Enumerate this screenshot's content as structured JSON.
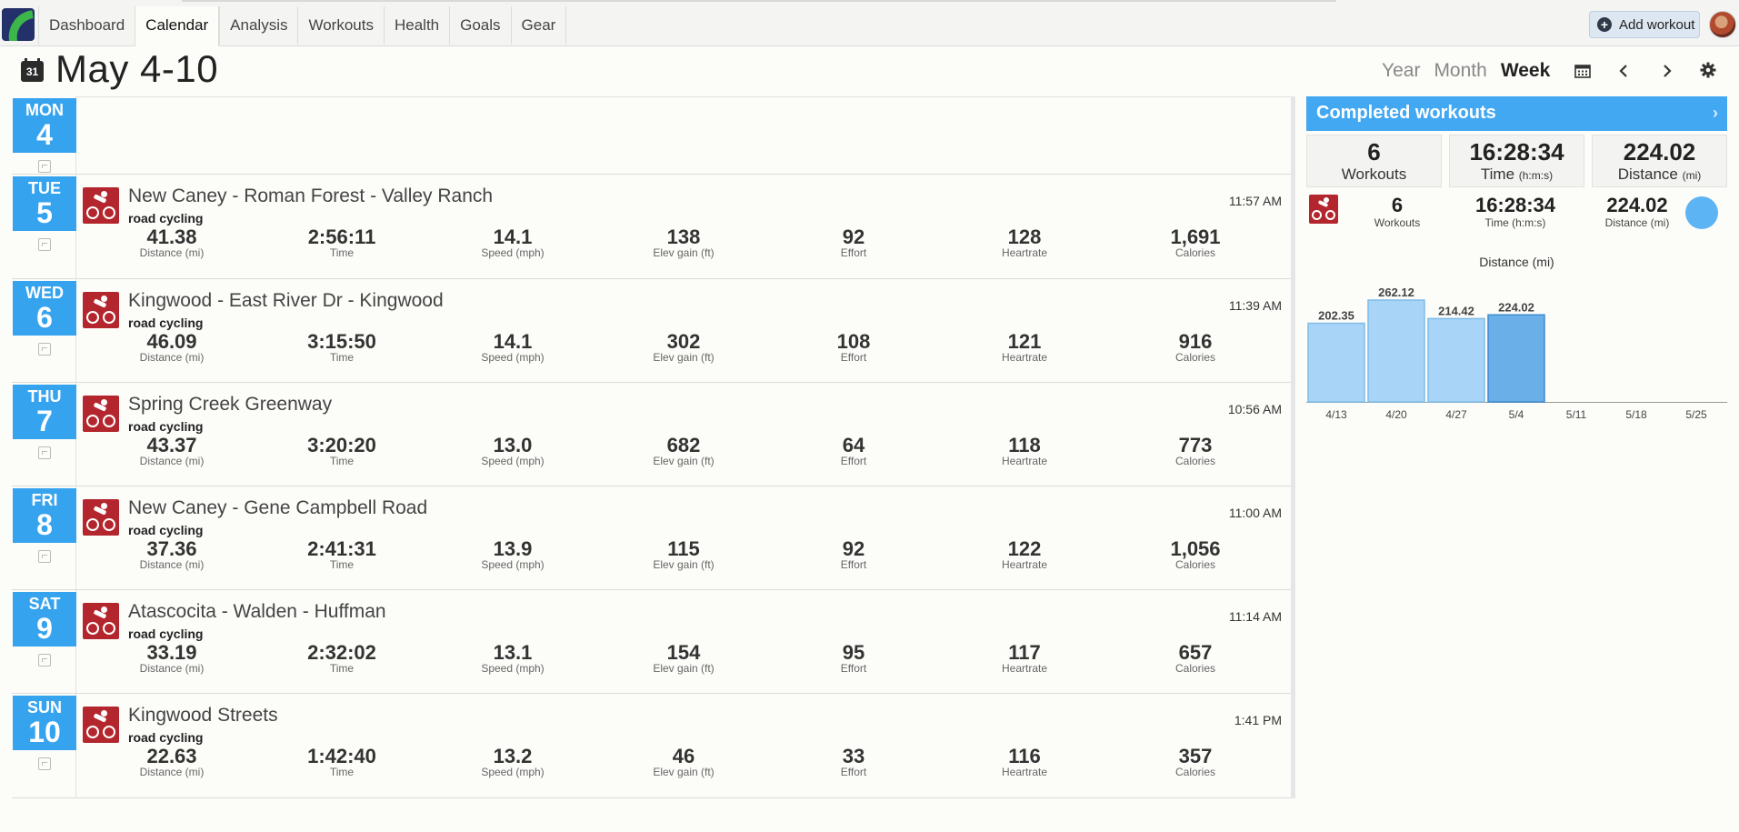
{
  "nav": {
    "tabs": [
      "Dashboard",
      "Calendar",
      "Analysis",
      "Workouts",
      "Health",
      "Goals",
      "Gear"
    ],
    "active_tab": "Calendar",
    "add_workout_label": "Add workout"
  },
  "header": {
    "calendar_icon_text": "31",
    "title": "May 4-10",
    "views": [
      "Year",
      "Month",
      "Week"
    ],
    "active_view": "Week"
  },
  "days": [
    {
      "dow": "MON",
      "dom": "4",
      "workout": null
    },
    {
      "dow": "TUE",
      "dom": "5",
      "workout": {
        "title": "New Caney - Roman Forest - Valley Ranch",
        "type": "road cycling",
        "time": "11:57 AM",
        "metrics": [
          {
            "value": "41.38",
            "label": "Distance (mi)"
          },
          {
            "value": "2:56:11",
            "label": "Time"
          },
          {
            "value": "14.1",
            "label": "Speed (mph)"
          },
          {
            "value": "138",
            "label": "Elev gain (ft)"
          },
          {
            "value": "92",
            "label": "Effort"
          },
          {
            "value": "128",
            "label": "Heartrate"
          },
          {
            "value": "1,691",
            "label": "Calories"
          }
        ]
      }
    },
    {
      "dow": "WED",
      "dom": "6",
      "workout": {
        "title": "Kingwood - East River Dr - Kingwood",
        "type": "road cycling",
        "time": "11:39 AM",
        "metrics": [
          {
            "value": "46.09",
            "label": "Distance (mi)"
          },
          {
            "value": "3:15:50",
            "label": "Time"
          },
          {
            "value": "14.1",
            "label": "Speed (mph)"
          },
          {
            "value": "302",
            "label": "Elev gain (ft)"
          },
          {
            "value": "108",
            "label": "Effort"
          },
          {
            "value": "121",
            "label": "Heartrate"
          },
          {
            "value": "916",
            "label": "Calories"
          }
        ]
      }
    },
    {
      "dow": "THU",
      "dom": "7",
      "workout": {
        "title": "Spring Creek Greenway",
        "type": "road cycling",
        "time": "10:56 AM",
        "metrics": [
          {
            "value": "43.37",
            "label": "Distance (mi)"
          },
          {
            "value": "3:20:20",
            "label": "Time"
          },
          {
            "value": "13.0",
            "label": "Speed (mph)"
          },
          {
            "value": "682",
            "label": "Elev gain (ft)"
          },
          {
            "value": "64",
            "label": "Effort"
          },
          {
            "value": "118",
            "label": "Heartrate"
          },
          {
            "value": "773",
            "label": "Calories"
          }
        ]
      }
    },
    {
      "dow": "FRI",
      "dom": "8",
      "workout": {
        "title": "New Caney - Gene Campbell Road",
        "type": "road cycling",
        "time": "11:00 AM",
        "metrics": [
          {
            "value": "37.36",
            "label": "Distance (mi)"
          },
          {
            "value": "2:41:31",
            "label": "Time"
          },
          {
            "value": "13.9",
            "label": "Speed (mph)"
          },
          {
            "value": "115",
            "label": "Elev gain (ft)"
          },
          {
            "value": "92",
            "label": "Effort"
          },
          {
            "value": "122",
            "label": "Heartrate"
          },
          {
            "value": "1,056",
            "label": "Calories"
          }
        ]
      }
    },
    {
      "dow": "SAT",
      "dom": "9",
      "workout": {
        "title": "Atascocita - Walden - Huffman",
        "type": "road cycling",
        "time": "11:14 AM",
        "metrics": [
          {
            "value": "33.19",
            "label": "Distance (mi)"
          },
          {
            "value": "2:32:02",
            "label": "Time"
          },
          {
            "value": "13.1",
            "label": "Speed (mph)"
          },
          {
            "value": "154",
            "label": "Elev gain (ft)"
          },
          {
            "value": "95",
            "label": "Effort"
          },
          {
            "value": "117",
            "label": "Heartrate"
          },
          {
            "value": "657",
            "label": "Calories"
          }
        ]
      }
    },
    {
      "dow": "SUN",
      "dom": "10",
      "workout": {
        "title": "Kingwood Streets",
        "type": "road cycling",
        "time": "1:41 PM",
        "metrics": [
          {
            "value": "22.63",
            "label": "Distance (mi)"
          },
          {
            "value": "1:42:40",
            "label": "Time"
          },
          {
            "value": "13.2",
            "label": "Speed (mph)"
          },
          {
            "value": "46",
            "label": "Elev gain (ft)"
          },
          {
            "value": "33",
            "label": "Effort"
          },
          {
            "value": "116",
            "label": "Heartrate"
          },
          {
            "value": "357",
            "label": "Calories"
          }
        ]
      }
    }
  ],
  "summary": {
    "title": "Completed workouts",
    "boxes": [
      {
        "value": "6",
        "label": "Workouts",
        "unit": ""
      },
      {
        "value": "16:28:34",
        "label": "Time",
        "unit": "(h:m:s)"
      },
      {
        "value": "224.02",
        "label": "Distance",
        "unit": "(mi)"
      }
    ],
    "sport_row": [
      {
        "value": "6",
        "label": "Workouts"
      },
      {
        "value": "16:28:34",
        "label": "Time (h:m:s)"
      },
      {
        "value": "224.02",
        "label": "Distance (mi)"
      }
    ]
  },
  "colors": {
    "accent": "#36a3ef",
    "sport": "#b3262d",
    "bar": "#a8d5f7",
    "bar_current": "#6aafe8"
  },
  "chart_data": {
    "type": "bar",
    "title": "Distance (mi)",
    "categories": [
      "4/13",
      "4/20",
      "4/27",
      "5/4",
      "5/11",
      "5/18",
      "5/25"
    ],
    "values": [
      202.35,
      262.12,
      214.42,
      224.02,
      null,
      null,
      null
    ],
    "highlight": "5/4",
    "ylim": [
      0,
      262.12
    ]
  }
}
